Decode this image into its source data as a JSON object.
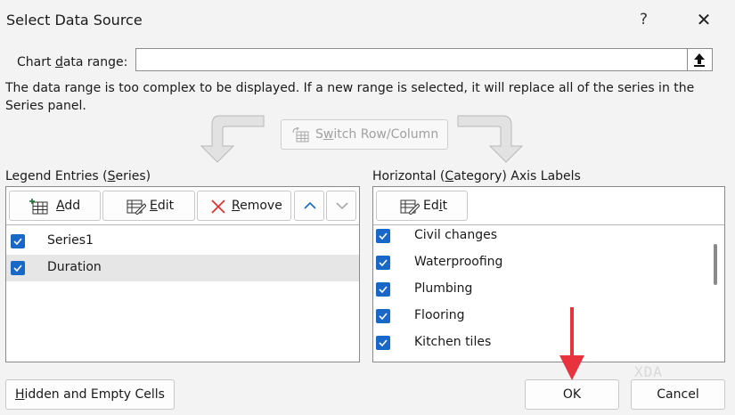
{
  "dialog": {
    "title": "Select Data Source",
    "help_label": "?",
    "close_label": "✕"
  },
  "range": {
    "label_pre": "Chart ",
    "label_u": "d",
    "label_post": "ata range:",
    "value": ""
  },
  "info_text": "The data range is too complex to be displayed. If a new range is selected, it will replace all of the series in the Series panel.",
  "switch": {
    "label_u": "w",
    "label_pre": "S",
    "label_post": "itch Row/Column",
    "enabled": false
  },
  "legend": {
    "label_pre": "Legend Entries (",
    "label_u": "S",
    "label_post": "eries)",
    "add": {
      "u": "A",
      "rest": "dd"
    },
    "edit": {
      "u": "E",
      "rest": "dit"
    },
    "remove": {
      "u": "R",
      "rest": "emove"
    },
    "up_icon": "chevron-up-icon",
    "down_icon": "chevron-down-icon",
    "items": [
      {
        "label": "Series1",
        "checked": true,
        "selected": false
      },
      {
        "label": "Duration",
        "checked": true,
        "selected": true
      }
    ]
  },
  "axis": {
    "label_pre": "Horizontal (",
    "label_u": "C",
    "label_post": "ategory) Axis Labels",
    "edit": {
      "pre": "Ed",
      "u": "i",
      "rest": "t"
    },
    "items": [
      {
        "label": "Civil changes",
        "checked": true
      },
      {
        "label": "Waterproofing",
        "checked": true
      },
      {
        "label": "Plumbing",
        "checked": true
      },
      {
        "label": "Flooring",
        "checked": true
      },
      {
        "label": "Kitchen tiles",
        "checked": true
      }
    ]
  },
  "buttons": {
    "hidden": {
      "u": "H",
      "rest": "idden and Empty Cells"
    },
    "ok": "OK",
    "cancel": "Cancel"
  },
  "watermark": "XDA",
  "colors": {
    "accent": "#1967c6",
    "annotation_arrow": "#e8333f"
  }
}
